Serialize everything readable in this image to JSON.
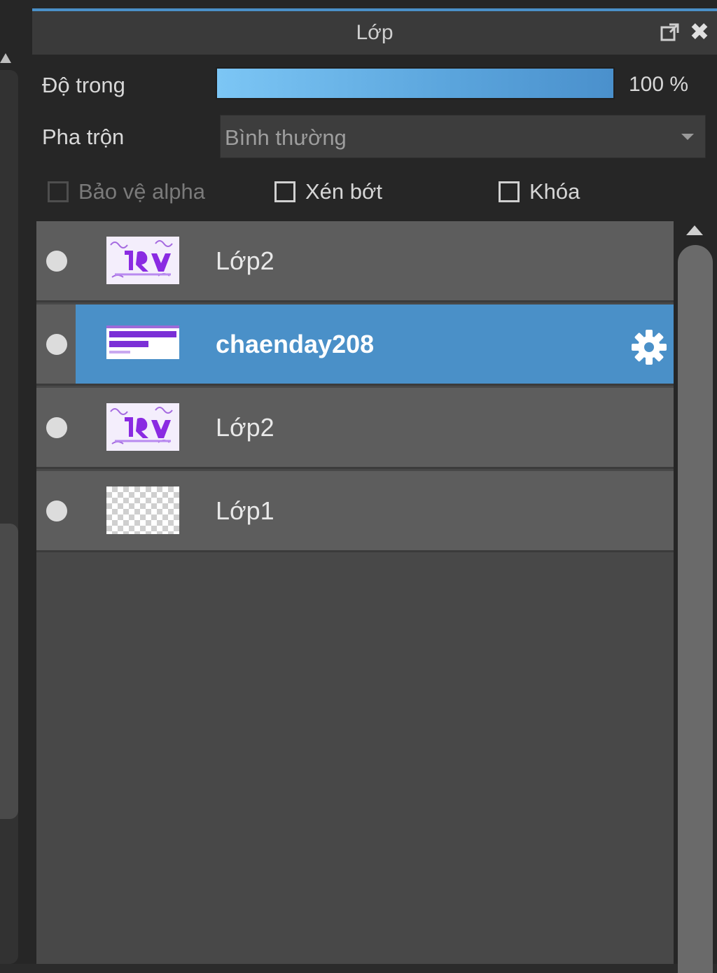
{
  "panel": {
    "title": "Lớp",
    "icons": {
      "popout": "popout-icon",
      "close": "close-icon",
      "close_glyph": "✖"
    }
  },
  "opacity": {
    "label": "Độ trong",
    "value_text": "100 %",
    "value": 100
  },
  "blend": {
    "label": "Pha trộn",
    "value": "Bình thường"
  },
  "checks": {
    "protect_alpha": {
      "label": "Bảo vệ alpha",
      "checked": false,
      "enabled": false
    },
    "clip": {
      "label": "Xén bớt",
      "checked": false,
      "enabled": true
    },
    "lock": {
      "label": "Khóa",
      "checked": false,
      "enabled": true
    }
  },
  "layers": [
    {
      "name": "Lớp2",
      "visible": true,
      "selected": false,
      "thumb": "purple-text-thumbnail"
    },
    {
      "name": "chaenday208",
      "visible": true,
      "selected": true,
      "thumb": "text-layer-thumbnail"
    },
    {
      "name": "Lớp2",
      "visible": true,
      "selected": false,
      "thumb": "purple-text-thumbnail"
    },
    {
      "name": "Lớp1",
      "visible": true,
      "selected": false,
      "thumb": "transparent-thumbnail"
    }
  ],
  "colors": {
    "accent": "#4a90c8",
    "panel_bg": "#262626",
    "layer_bg": "#5d5d5d",
    "list_bg": "#484848",
    "thumb_purple": "#8a2be2"
  }
}
